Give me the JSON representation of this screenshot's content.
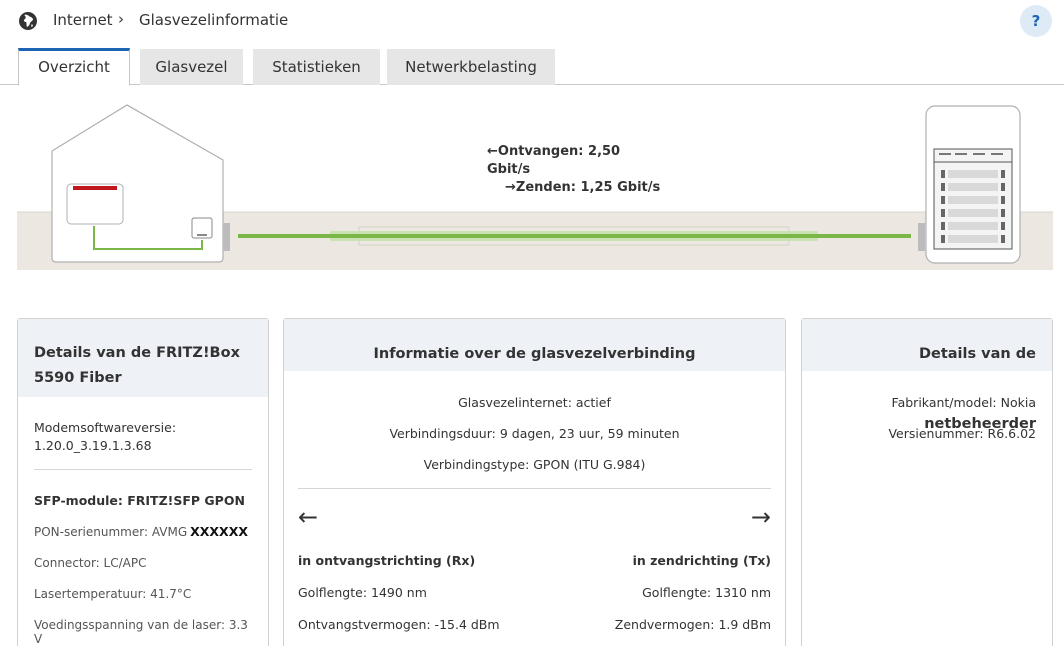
{
  "header": {
    "breadcrumb_home": "Internet",
    "breadcrumb_separator": "›",
    "breadcrumb_page": "Glasvezelinformatie",
    "help_label": "?"
  },
  "tabs": [
    {
      "label": "Overzicht",
      "active": true
    },
    {
      "label": "Glasvezel",
      "active": false
    },
    {
      "label": "Statistieken",
      "active": false
    },
    {
      "label": "Netwerkbelasting",
      "active": false
    }
  ],
  "diagram": {
    "receive_label": "Ontvangen: 2,50 Gbit/s",
    "send_label": "Zenden: 1,25 Gbit/s",
    "fiber_color": "#7ab648",
    "router_accent": "#c0161d"
  },
  "fritzbox_card": {
    "title": "Details van de FRITZ!Box 5590 Fiber",
    "firmware_label": "Modemsoftwareversie:",
    "firmware_value": "1.20.0_3.19.1.3.68",
    "sfp_title": "SFP-module: FRITZ!SFP GPON",
    "pon_serial_label": "PON-serienummer: AVMG",
    "pon_serial_masked": "XXXXXX",
    "connector": "Connector: LC/APC",
    "laser_temp": "Lasertemperatuur: 41.7°C",
    "laser_voltage": "Voedingsspanning van de laser: 3.3 V"
  },
  "fiber_card": {
    "title": "Informatie over de glasvezelverbinding",
    "status": "Glasvezelinternet: actief",
    "duration": "Verbindingsduur: 9 dagen, 23 uur, 59 minuten",
    "type": "Verbindingstype: GPON (ITU G.984)",
    "rx_title": "in ontvangstrichting (Rx)",
    "rx_wavelength": "Golflengte: 1490 nm",
    "rx_power": "Ontvangstvermogen: -15.4 dBm",
    "tx_title": "in zendrichting (Tx)",
    "tx_wavelength": "Golflengte: 1310 nm",
    "tx_power": "Zendvermogen: 1.9 dBm"
  },
  "operator_card": {
    "title": "Details van de netbeheerder",
    "manufacturer": "Fabrikant/model: Nokia",
    "version": "Versienummer: R6.6.02"
  }
}
